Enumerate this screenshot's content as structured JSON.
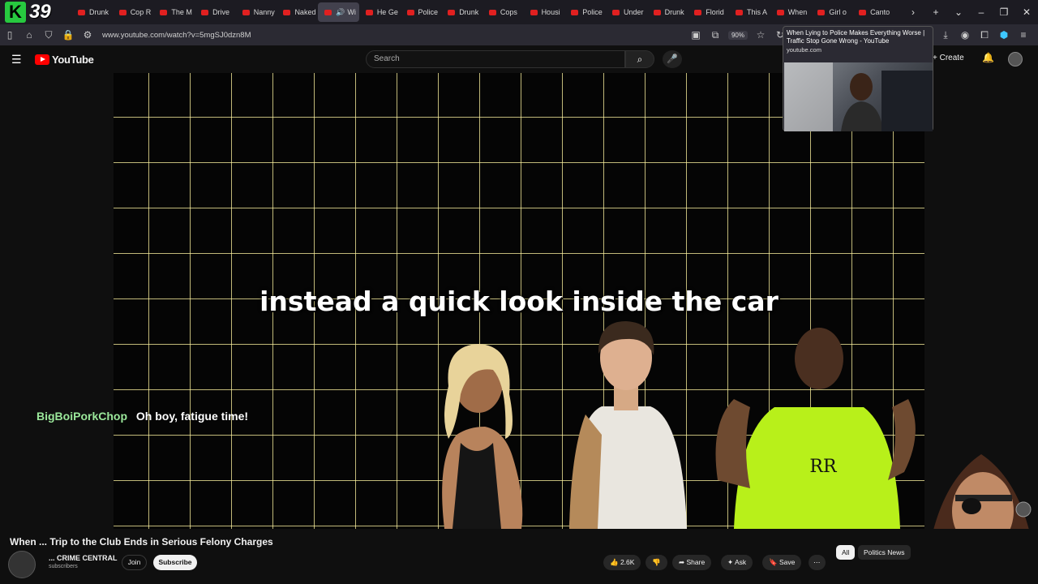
{
  "browser": {
    "tab_count": "39",
    "tabs": [
      {
        "label": "Drunk"
      },
      {
        "label": "Cop R"
      },
      {
        "label": "The M"
      },
      {
        "label": "Drive"
      },
      {
        "label": "Nanny"
      },
      {
        "label": "Naked"
      },
      {
        "label": "Wi"
      },
      {
        "label": "He Ge"
      },
      {
        "label": "Police"
      },
      {
        "label": "Drunk"
      },
      {
        "label": "Cops"
      },
      {
        "label": "Housi"
      },
      {
        "label": "Police"
      },
      {
        "label": "Under"
      },
      {
        "label": "Drunk"
      },
      {
        "label": "Florid"
      },
      {
        "label": "This A"
      },
      {
        "label": "When"
      },
      {
        "label": "Girl o"
      },
      {
        "label": "Canto"
      }
    ],
    "url": "www.youtube.com/watch?v=5mgSJ0dzn8M",
    "zoom": "90%",
    "tooltip": {
      "title": "When Lying to Police Makes Everything Worse | Traffic Stop Gone Wrong - YouTube",
      "url": "youtube.com"
    }
  },
  "youtube": {
    "logo_text": "YouTube",
    "search_placeholder": "Search",
    "create_label": "Create"
  },
  "video": {
    "caption": "instead a quick look inside the car",
    "overlay_user": "BigBoiPorkChop",
    "overlay_message": "Oh boy, fatigue time!",
    "title": "When ... Trip to the Club Ends in Serious Felony Charges",
    "channel_name": "... CRIME CENTRAL",
    "channel_subs": "subscribers",
    "join_label": "Join",
    "subscribe_label": "Subscribe",
    "likes": "2.6K",
    "share_label": "Share",
    "ask_label": "Ask",
    "save_label": "Save"
  },
  "chips": {
    "all": "All",
    "politics": "Politics News"
  }
}
